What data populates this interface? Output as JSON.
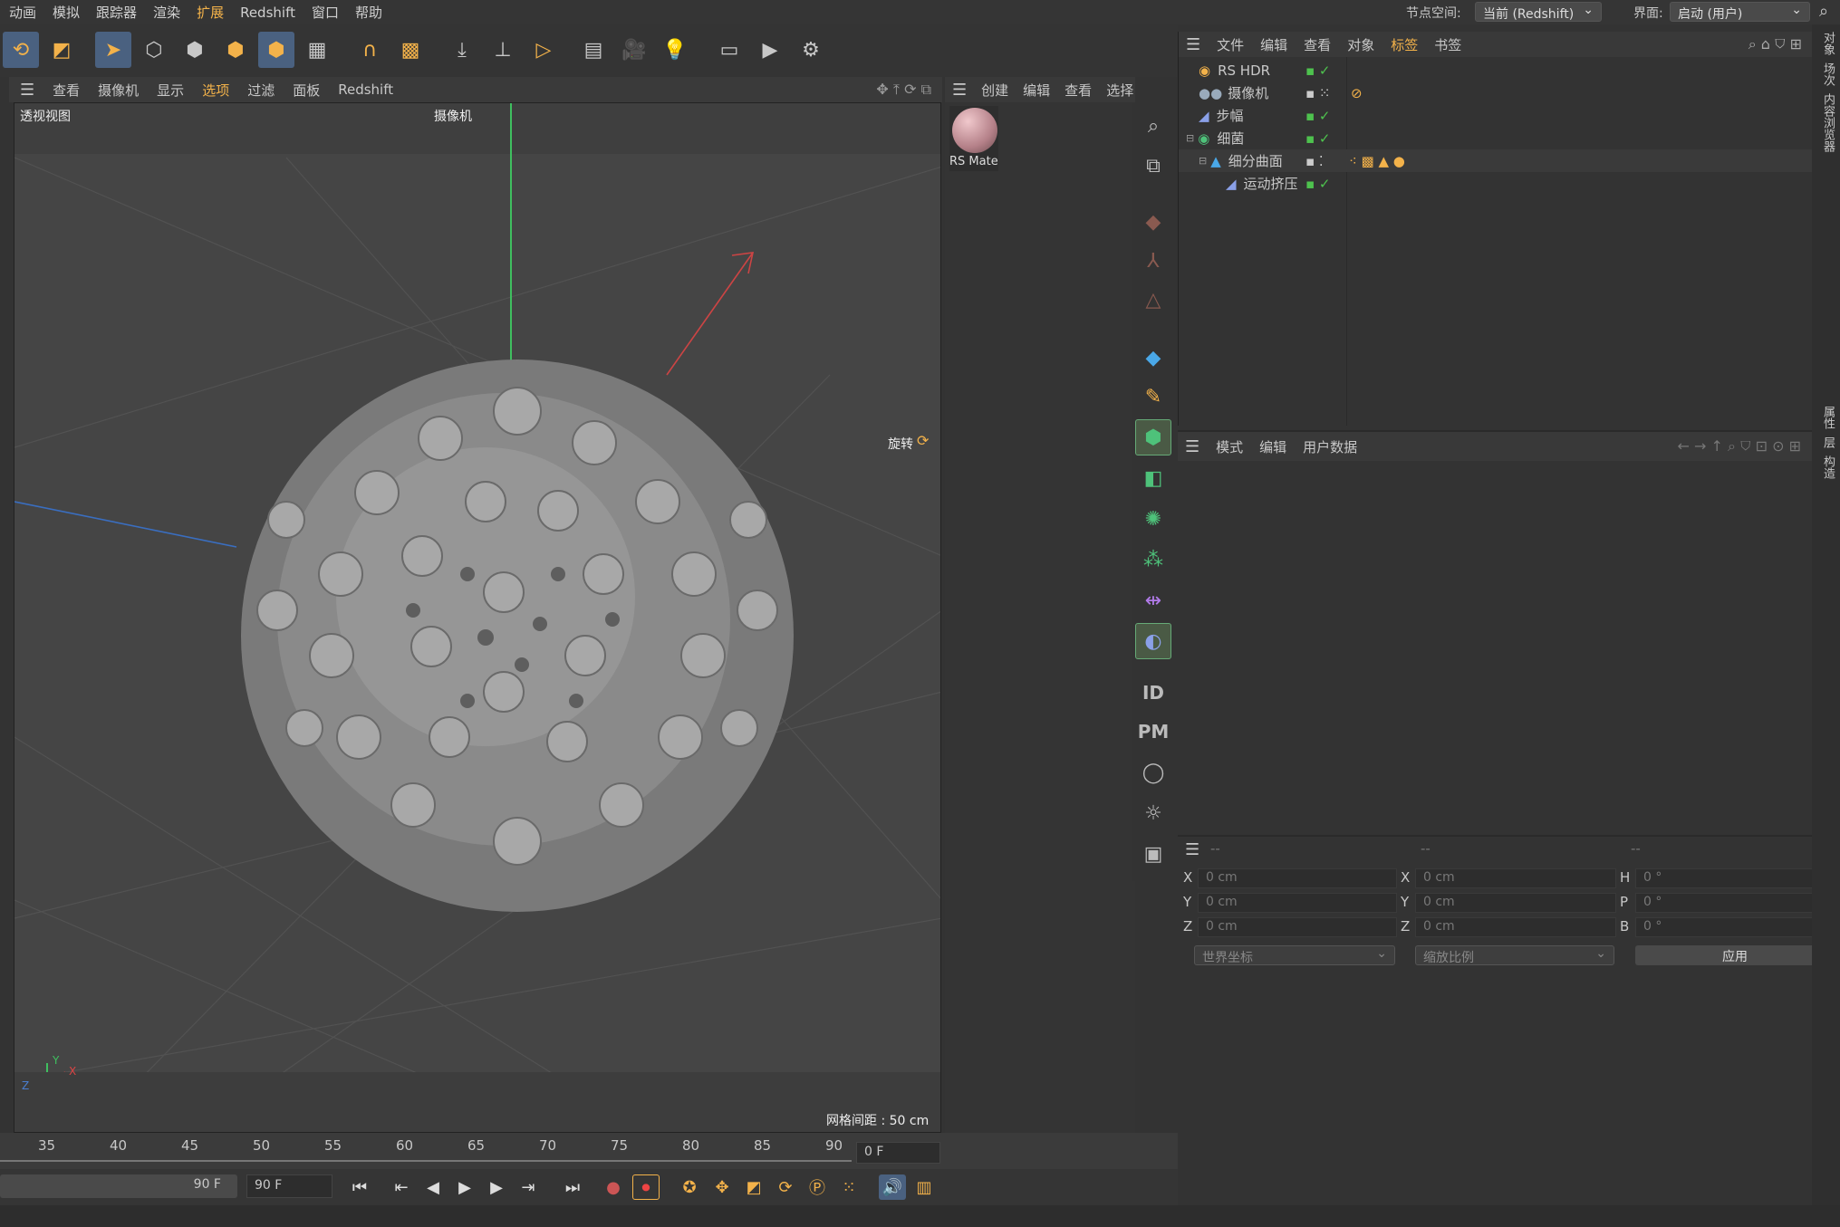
{
  "menubar": {
    "items": [
      "动画",
      "模拟",
      "跟踪器",
      "渲染",
      "扩展",
      "Redshift",
      "窗口",
      "帮助"
    ]
  },
  "topright": {
    "node_space_label": "节点空间:",
    "node_space_value": "当前 (Redshift)",
    "layout_label": "界面:",
    "layout_value": "启动 (用户)"
  },
  "viewport_menu": {
    "items": [
      "查看",
      "摄像机",
      "显示",
      "选项",
      "过滤",
      "面板",
      "Redshift"
    ]
  },
  "viewport": {
    "name": "透视视图",
    "camera": "摄像机",
    "rotate_label": "旋转",
    "grid_spacing": "网格间距 : 50 cm",
    "axis_x": "X",
    "axis_y": "Y",
    "axis_z": "Z"
  },
  "material_panel": {
    "menu": [
      "创建",
      "编辑",
      "查看",
      "选择"
    ],
    "material_name": "RS Mate"
  },
  "object_panel": {
    "menu": [
      "文件",
      "编辑",
      "查看",
      "对象",
      "标签",
      "书签"
    ],
    "objects": [
      {
        "name": "RS HDR",
        "indent": 0
      },
      {
        "name": "摄像机",
        "indent": 0
      },
      {
        "name": "步幅",
        "indent": 0
      },
      {
        "name": "细菌",
        "indent": 0
      },
      {
        "name": "细分曲面",
        "indent": 1
      },
      {
        "name": "运动挤压",
        "indent": 2
      }
    ]
  },
  "attr_panel": {
    "menu": [
      "模式",
      "编辑",
      "用户数据"
    ]
  },
  "coord_panel": {
    "headers": [
      "--",
      "--",
      "--"
    ],
    "rows": [
      {
        "a": "X",
        "av": "0 cm",
        "b": "X",
        "bv": "0 cm",
        "c": "H",
        "cv": "0 °"
      },
      {
        "a": "Y",
        "av": "0 cm",
        "b": "Y",
        "bv": "0 cm",
        "c": "P",
        "cv": "0 °"
      },
      {
        "a": "Z",
        "av": "0 cm",
        "b": "Z",
        "bv": "0 cm",
        "c": "B",
        "cv": "0 °"
      }
    ],
    "coord_system": "世界坐标",
    "scale_mode": "缩放比例",
    "apply": "应用"
  },
  "right_strip": {
    "tabs_top": [
      "对象",
      "场次",
      "内容浏览器"
    ],
    "tabs_bottom": [
      "属性",
      "层",
      "构造"
    ]
  },
  "timeline": {
    "ticks": [
      "35",
      "40",
      "45",
      "50",
      "55",
      "60",
      "65",
      "70",
      "75",
      "80",
      "85",
      "90"
    ],
    "current_frame": "0 F"
  },
  "transport": {
    "end_frame_a": "90 F",
    "end_frame_b": "90 F"
  },
  "vtool_labels": {
    "id": "ID",
    "pm": "PM"
  },
  "colors": {
    "accent": "#f3b24a",
    "highlight": "#4a6180",
    "check": "#4ec24e"
  }
}
